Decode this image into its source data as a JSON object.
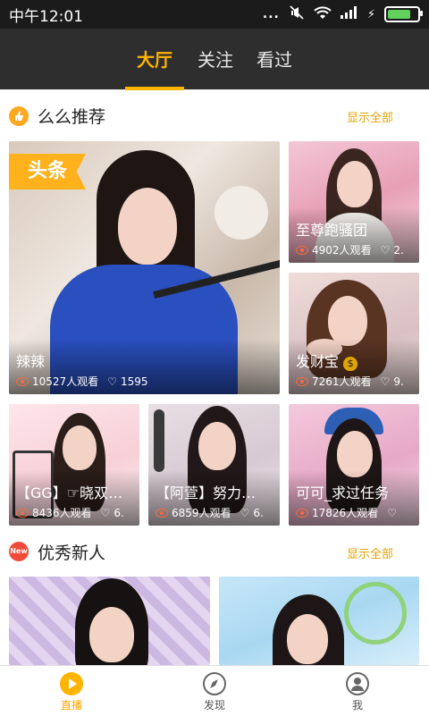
{
  "status_bar": {
    "time": "中午12:01",
    "dots": "...",
    "battery_level": 0.9
  },
  "tabs": [
    {
      "label": "大厅",
      "active": true
    },
    {
      "label": "关注",
      "active": false
    },
    {
      "label": "看过",
      "active": false
    }
  ],
  "sections": {
    "recommend": {
      "title": "么么推荐",
      "more": "显示全部",
      "icon": "thumbs-up-icon"
    },
    "newcomers": {
      "title": "优秀新人",
      "more": "显示全部",
      "icon": "new-badge-icon",
      "icon_text": "New"
    }
  },
  "featured": {
    "badge": "头条",
    "title": "辣辣",
    "viewers": "10527人观看",
    "likes": "1595"
  },
  "cards": [
    {
      "title": "至尊跑骚团",
      "viewers": "4902人观看",
      "likes": "2."
    },
    {
      "title": "发财宝",
      "viewers": "7261人观看",
      "likes": "9."
    },
    {
      "title": "【GG】☞晓双…",
      "viewers": "8436人观看",
      "likes": "6."
    },
    {
      "title": "【阿萱】努力…",
      "viewers": "6859人观看",
      "likes": "6."
    },
    {
      "title": "可可_求过任务",
      "viewers": "17826人观看",
      "likes": ""
    }
  ],
  "bottom_nav": [
    {
      "label": "直播",
      "icon": "play-icon",
      "active": true
    },
    {
      "label": "发现",
      "icon": "compass-icon",
      "active": false
    },
    {
      "label": "我",
      "icon": "profile-icon",
      "active": false
    }
  ],
  "colors": {
    "accent": "#ffb400",
    "nav_bg": "#2e2e2e",
    "status_bg": "#1b1b1b"
  }
}
